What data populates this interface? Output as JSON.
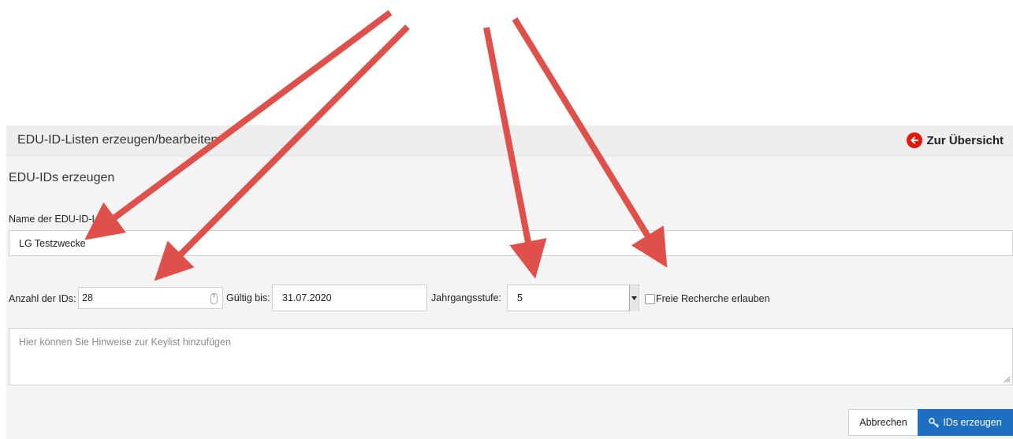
{
  "header": {
    "title": "EDU-ID-Listen erzeugen/bearbeiten",
    "back_label": "Zur Übersicht"
  },
  "section": {
    "title": "EDU-IDs erzeugen"
  },
  "form": {
    "name_label": "Name der EDU-ID-Liste:",
    "name_value": "LG Testzwecke",
    "count_label": "Anzahl der IDs:",
    "count_value": "28",
    "valid_label": "Gültig bis:",
    "valid_value": "31.07.2020",
    "grade_label": "Jahrgangsstufe:",
    "grade_value": "5",
    "free_research_label": "Freie Recherche erlauben",
    "free_research_checked": false,
    "notes_placeholder": "Hier können Sie Hinweise zur Keylist hinzufügen"
  },
  "actions": {
    "cancel_label": "Abbrechen",
    "create_label": "IDs erzeugen"
  },
  "colors": {
    "accent": "#1e6fbf",
    "back_icon": "#e3170a",
    "annotation_arrow": "#e0504a"
  },
  "icons": {
    "back": "arrow-left-circle-icon",
    "create": "key-icon"
  }
}
